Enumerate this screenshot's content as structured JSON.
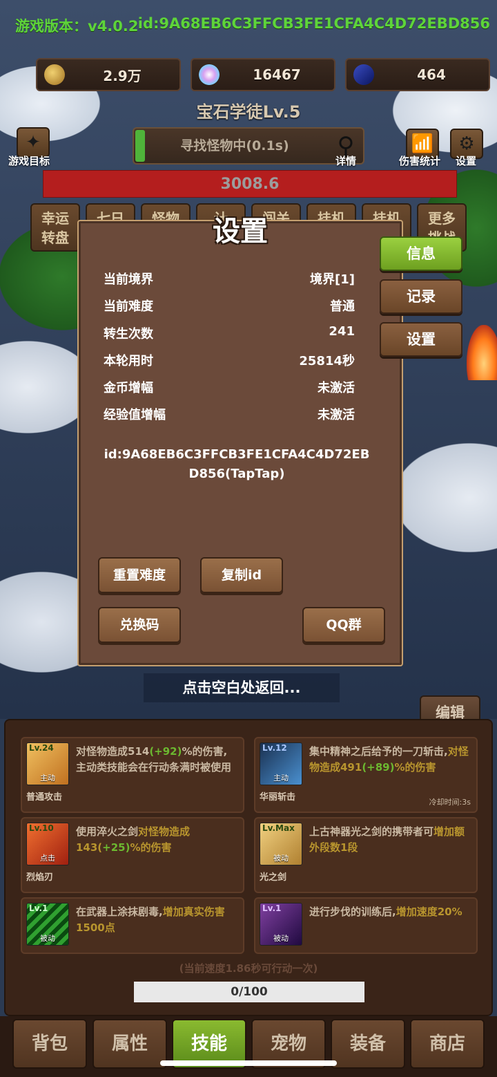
{
  "header": {
    "version": "游戏版本：v4.0.2",
    "game_id": "id:9A68EB6C3FFCB3FE1CFA4C4D72EBD856"
  },
  "resources": [
    {
      "icon": "coin-icon",
      "value": "2.9万"
    },
    {
      "icon": "crystal-icon",
      "value": "16467"
    },
    {
      "icon": "card-icon",
      "value": "464"
    }
  ],
  "player_level": "宝石学徒Lv.5",
  "search": {
    "text": "寻找怪物中(0.1s)",
    "detail_label": "详情"
  },
  "left_icons": {
    "goal_label": "游戏目标"
  },
  "right_icons": {
    "damage_label": "伤害统计",
    "settings_label": "设置"
  },
  "hp_value": "3008.6",
  "feature_buttons": [
    {
      "label": "幸运\n转盘"
    },
    {
      "label": "七日"
    },
    {
      "label": "怪物"
    },
    {
      "label": "计"
    },
    {
      "label": "闯关"
    },
    {
      "label": "挂机"
    },
    {
      "label": "挂机"
    },
    {
      "label": "更多\n挑战"
    }
  ],
  "modal": {
    "title": "设置",
    "rows": [
      {
        "key": "当前境界",
        "value": "境界[1]"
      },
      {
        "key": "当前难度",
        "value": "普通"
      },
      {
        "key": "转生次数",
        "value": "241"
      },
      {
        "key": "本轮用时",
        "value": "25814秒"
      },
      {
        "key": "金币增幅",
        "value": "未激活"
      },
      {
        "key": "经验值增幅",
        "value": "未激活"
      }
    ],
    "id_text": "id:9A68EB6C3FFCB3FE1CFA4C4D72EBD856(TapTap)",
    "buttons": {
      "reset": "重置难度",
      "copy": "复制id",
      "redeem": "兑换码",
      "qq": "QQ群"
    },
    "tabs": [
      {
        "label": "信息",
        "active": true
      },
      {
        "label": "记录",
        "active": false
      },
      {
        "label": "设置",
        "active": false
      }
    ]
  },
  "back_hint": "点击空白处返回...",
  "edit_label": "编辑",
  "skills": [
    {
      "level": "Lv.24",
      "type": "主动",
      "name": "普通攻击",
      "desc_parts": [
        [
          "w",
          "对怪物造成514"
        ],
        [
          "g",
          "(+92)"
        ],
        [
          "w",
          "%的伤害,主动类技能会在行动条满时被使用"
        ]
      ],
      "cooldown": ""
    },
    {
      "level": "Lv.12",
      "type": "主动",
      "name": "华丽斩击",
      "desc_parts": [
        [
          "w",
          "集中精神之后给予的一刀斩击,"
        ],
        [
          "y",
          "对怪物造成491"
        ],
        [
          "g",
          "(+89)"
        ],
        [
          "y",
          "%的伤害"
        ]
      ],
      "cooldown": "冷却时间:3s"
    },
    {
      "level": "Lv.10",
      "type": "点击",
      "name": "烈焰刃",
      "desc_parts": [
        [
          "w",
          "使用淬火之剑"
        ],
        [
          "y",
          "对怪物造成143("
        ],
        [
          "g",
          "+25)"
        ],
        [
          "y",
          "%的伤害"
        ]
      ],
      "cooldown": ""
    },
    {
      "level": "Lv.Max",
      "type": "被动",
      "name": "光之剑",
      "desc_parts": [
        [
          "w",
          "上古神器光之剑的携带者可"
        ],
        [
          "y",
          "增加额外段数1段"
        ]
      ],
      "cooldown": ""
    },
    {
      "level": "Lv.1",
      "type": "被动",
      "name": "",
      "desc_parts": [
        [
          "w",
          "在武器上涂抹剧毒,"
        ],
        [
          "y",
          "增加真实伤害1500点"
        ]
      ],
      "cooldown": ""
    },
    {
      "level": "Lv.1",
      "type": "被动",
      "name": "",
      "desc_parts": [
        [
          "w",
          "进行步伐的训练后,"
        ],
        [
          "y",
          "增加速度20%"
        ]
      ],
      "cooldown": ""
    }
  ],
  "speed_text": "(当前速度1.86秒可行动一次)",
  "progress_text": "0/100",
  "nav": [
    {
      "label": "背包",
      "active": false
    },
    {
      "label": "属性",
      "active": false
    },
    {
      "label": "技能",
      "active": true
    },
    {
      "label": "宠物",
      "active": false
    },
    {
      "label": "装备",
      "active": false
    },
    {
      "label": "商店",
      "active": false
    }
  ],
  "colors": {
    "accent_green": "#5ed43a",
    "hp_red": "#b41e1e",
    "modal_bg": "#6b4a3a",
    "active_tab": "#9ad040"
  }
}
